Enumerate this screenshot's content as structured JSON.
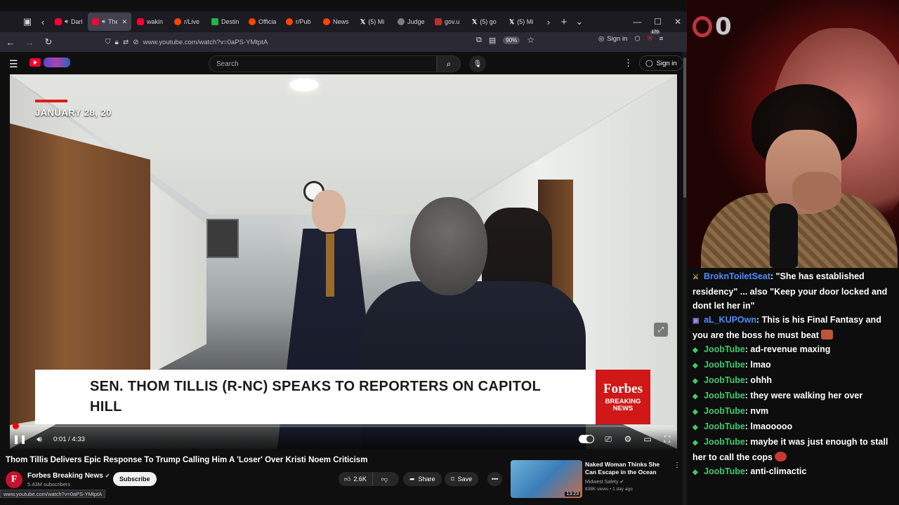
{
  "browser": {
    "tabs": [
      {
        "label": "Dark S",
        "icon": "youtube-icon",
        "audio": true,
        "active": false
      },
      {
        "label": "The",
        "icon": "youtube-icon",
        "audio": true,
        "active": true
      },
      {
        "label": "wakin",
        "icon": "youtube-icon",
        "audio": false,
        "active": false
      },
      {
        "label": "r/Live",
        "icon": "reddit-icon",
        "audio": false,
        "active": false
      },
      {
        "label": "Destin",
        "icon": "destiny-icon",
        "audio": false,
        "active": false
      },
      {
        "label": "Officia",
        "icon": "reddit-icon",
        "audio": false,
        "active": false
      },
      {
        "label": "r/Pub",
        "icon": "reddit-icon",
        "audio": false,
        "active": false
      },
      {
        "label": "News",
        "icon": "reddit-icon",
        "audio": false,
        "active": false
      },
      {
        "label": "(5) Mi",
        "icon": "x-icon",
        "audio": false,
        "active": false
      },
      {
        "label": "Judge",
        "icon": "google-icon",
        "audio": false,
        "active": false
      },
      {
        "label": "gov.u",
        "icon": "gov-icon",
        "audio": false,
        "active": false
      },
      {
        "label": "(5) go",
        "icon": "x-icon",
        "audio": false,
        "active": false
      },
      {
        "label": "(5) Mi",
        "icon": "x-icon",
        "audio": false,
        "active": false
      }
    ],
    "url": "www.youtube.com/watch?v=0aPS-YMtptA",
    "zoom": "90%",
    "sign_in": "Sign in",
    "extension_badge": "170",
    "status_url": "www.youtube.com/watch?v=0aPS-YMtptA"
  },
  "youtube": {
    "search_placeholder": "Search",
    "sign_in": "Sign in"
  },
  "video": {
    "date_overlay": "JANUARY 28, 20",
    "lower_third": "SEN. THOM TILLIS (R-NC) SPEAKS TO REPORTERS ON CAPITOL HILL",
    "brand": "Forbes",
    "brand_sub": "BREAKING NEWS",
    "time": "0:01 / 4:33",
    "progress": 0.004,
    "title": "Thom Tillis Delivers Epic Response To Trump Calling Him A 'Loser' Over Kristi Noem Criticism",
    "channel": "Forbes Breaking News",
    "subscribers": "5.43M subscribers",
    "subscribe_label": "Subscribe",
    "likes": "2.6K",
    "share_label": "Share",
    "save_label": "Save"
  },
  "recommendation": {
    "title": "Naked Woman Thinks She Can Escape in the Ocean",
    "channel": "Midwest Safety",
    "meta": "838K views • 1 day ago",
    "duration": "13:23"
  },
  "overlay": {
    "counter": "0"
  },
  "chat": [
    {
      "badge": "sword",
      "user": "BroknToiletSeat",
      "user_color": "#4c8dff",
      "text": ": \"She has established residency\" ... also \"Keep your door locked and dont let her in\"",
      "emote": false
    },
    {
      "badge": "box",
      "user": "aL_KUPOwn",
      "user_color": "#4c8dff",
      "text": ": This is his Final Fantasy and you are the boss he must beat",
      "emote": true
    },
    {
      "badge": "diamond",
      "user": "JoobTube",
      "user_color": "#43c96e",
      "text": ": ad-revenue maxing",
      "emote": false
    },
    {
      "badge": "diamond",
      "user": "JoobTube",
      "user_color": "#43c96e",
      "text": ": lmao",
      "emote": false
    },
    {
      "badge": "diamond",
      "user": "JoobTube",
      "user_color": "#43c96e",
      "text": ": ohhh",
      "emote": false
    },
    {
      "badge": "diamond",
      "user": "JoobTube",
      "user_color": "#43c96e",
      "text": ": they were walking her over",
      "emote": false
    },
    {
      "badge": "diamond",
      "user": "JoobTube",
      "user_color": "#43c96e",
      "text": ": nvm",
      "emote": false
    },
    {
      "badge": "diamond",
      "user": "JoobTube",
      "user_color": "#43c96e",
      "text": ": lmaooooo",
      "emote": false
    },
    {
      "badge": "diamond",
      "user": "JoobTube",
      "user_color": "#43c96e",
      "text": ": maybe it was just enough to stall her to call the cops",
      "emote": true
    },
    {
      "badge": "diamond",
      "user": "JoobTube",
      "user_color": "#43c96e",
      "text": ": anti-climactic",
      "emote": false
    }
  ],
  "colors": {
    "accent_red": "#ff0000",
    "forbes_red": "#d01818",
    "joob_green": "#43c96e",
    "user_blue": "#4c8dff"
  }
}
